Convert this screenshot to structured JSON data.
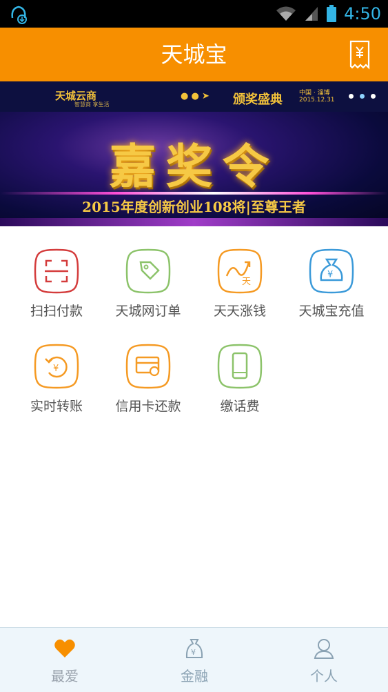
{
  "status_bar": {
    "time": "4:50"
  },
  "header": {
    "title": "天城宝"
  },
  "banner": {
    "brand_left": "天城云商",
    "brand_left_sub": "智慧商 享生活",
    "brand_right": "颁奖盛典",
    "brand_location": "中国 · 淄博",
    "brand_date": "2015.12.31",
    "main_text": "嘉奖令",
    "sub_text": "2015年度创新创业108将|至尊王者"
  },
  "features": [
    {
      "label": "扫扫付款",
      "icon": "scan-icon",
      "color": "#d43c3c"
    },
    {
      "label": "天城网订单",
      "icon": "tag-icon",
      "color": "#8cc36a"
    },
    {
      "label": "天天涨钱",
      "icon": "growth-icon",
      "color": "#f59a23"
    },
    {
      "label": "天城宝充值",
      "icon": "money-bag-icon",
      "color": "#3b9ad9"
    },
    {
      "label": "实时转账",
      "icon": "transfer-icon",
      "color": "#f59a23"
    },
    {
      "label": "信用卡还款",
      "icon": "credit-card-icon",
      "color": "#f59a23"
    },
    {
      "label": "缴话费",
      "icon": "phone-icon",
      "color": "#8cc36a"
    }
  ],
  "tabs": [
    {
      "label": "最爱",
      "icon": "heart-icon",
      "active": true
    },
    {
      "label": "金融",
      "icon": "finance-bag-icon",
      "active": false
    },
    {
      "label": "个人",
      "icon": "person-icon",
      "active": false
    }
  ],
  "colors": {
    "accent": "#f78f00",
    "tab_active_icon": "#f78f00",
    "tab_inactive_icon": "#8aa2b3"
  }
}
